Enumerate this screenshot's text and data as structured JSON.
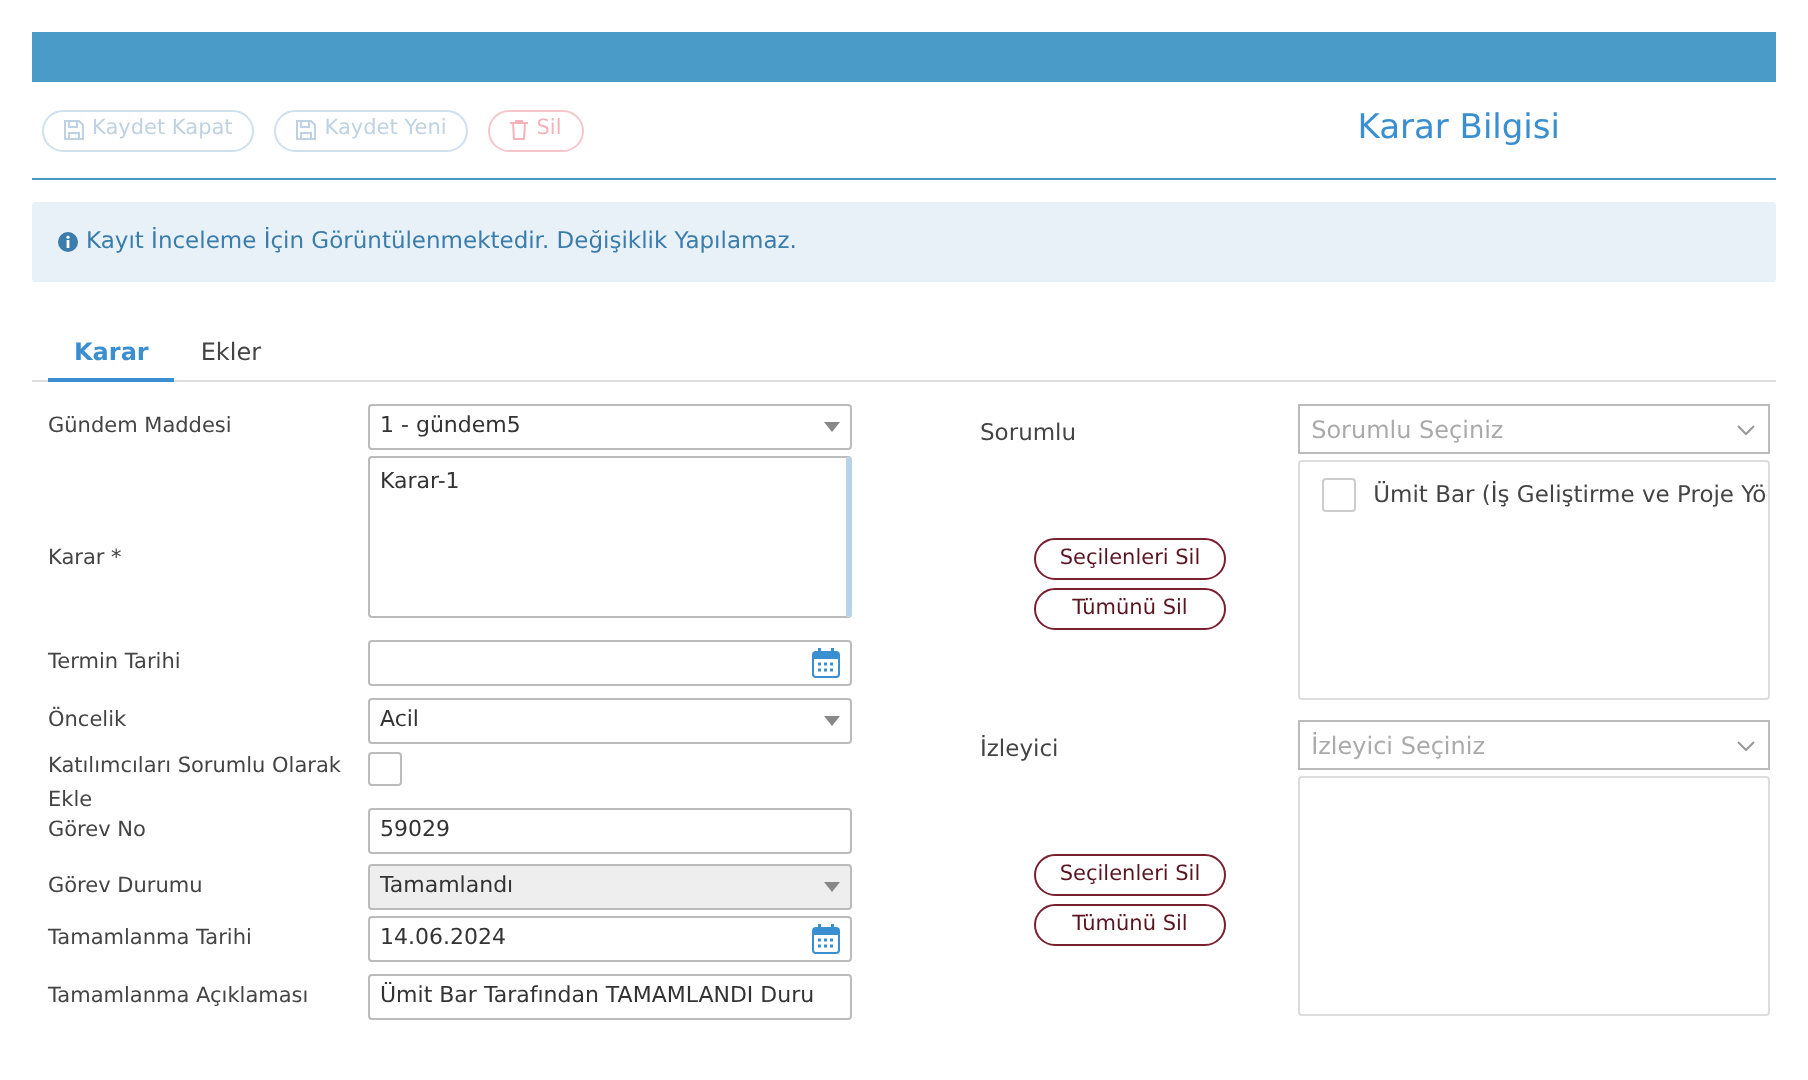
{
  "toolbar": {
    "buttons": [
      {
        "label": "Kaydet Kapat",
        "kind": "save",
        "disabled": true
      },
      {
        "label": "Kaydet Yeni",
        "kind": "save",
        "disabled": true
      },
      {
        "label": "Sil",
        "kind": "delete",
        "disabled": true
      }
    ],
    "title": "Karar Bilgisi"
  },
  "alert": {
    "text": "Kayıt İnceleme İçin Görüntülenmektedir. Değişiklik Yapılamaz."
  },
  "tabs": [
    {
      "label": "Karar",
      "selected": true
    },
    {
      "label": "Ekler",
      "selected": false
    }
  ],
  "form": [
    {
      "label": "Gündem Maddesi",
      "kind": "select",
      "value": "1 - gündem5",
      "disabled": false
    },
    {
      "label": "Karar *",
      "kind": "textarea",
      "value": "Karar-1",
      "disabled": false
    },
    {
      "label": "Termin Tarihi",
      "kind": "date",
      "disabled": false
    },
    {
      "label": "Öncelik",
      "kind": "select",
      "value": "Acil",
      "disabled": false
    },
    {
      "label": "Katılımcıları Sorumlu Olarak Ekle",
      "kind": "checkbox",
      "checked": false
    },
    {
      "label": "Görev No",
      "kind": "text",
      "value": "59029",
      "disabled": false
    },
    {
      "label": "Görev Durumu",
      "kind": "select",
      "value": "Tamamlandı",
      "disabled": true
    },
    {
      "label": "Tamamlanma Tarihi",
      "kind": "date",
      "value": "14.06.2024",
      "disabled": false
    },
    {
      "label": "Tamamlanma Açıklaması",
      "kind": "text",
      "value": "Ümit Bar Tarafından TAMAMLANDI Duru",
      "disabled": false
    }
  ],
  "pickers": [
    {
      "label": "Sorumlu",
      "placeholder": "Sorumlu Seçiniz",
      "items": [
        {
          "label": "Ümit Bar (İş Geliştirme ve Proje Yö",
          "checked": false
        }
      ],
      "buttons": [
        "Seçilenleri Sil",
        "Tümünü Sil"
      ]
    },
    {
      "label": "İzleyici",
      "placeholder": "İzleyici Seçiniz",
      "buttons": [
        "Seçilenleri Sil",
        "Tümünü Sil"
      ]
    }
  ]
}
